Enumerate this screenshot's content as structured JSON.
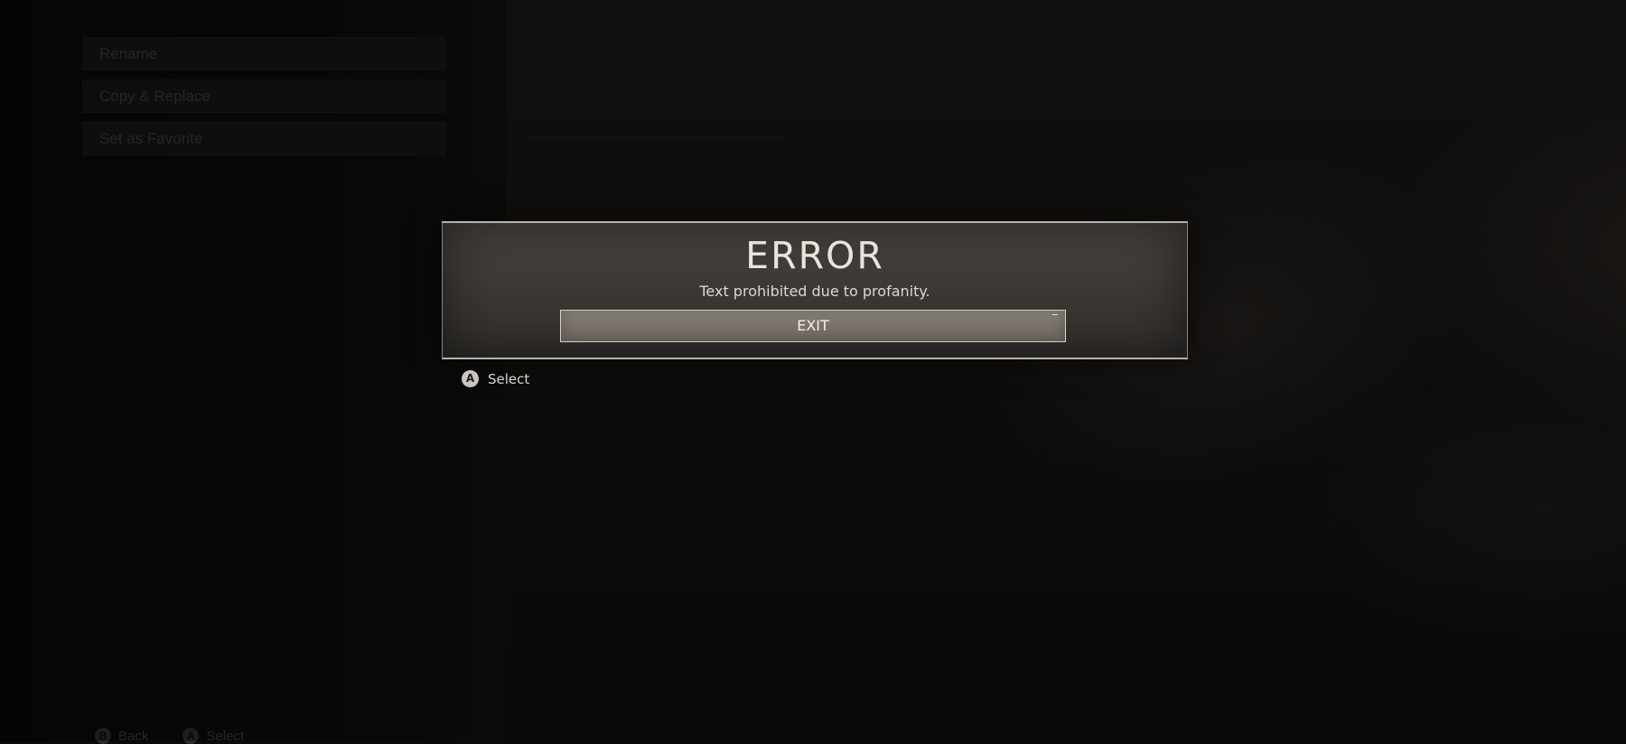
{
  "background": {
    "menu_items": [
      {
        "label": "Rename"
      },
      {
        "label": "Copy & Replace"
      },
      {
        "label": "Set as Favorite"
      }
    ],
    "bottom_prompts": [
      {
        "button": "B",
        "label": "Back"
      },
      {
        "button": "A",
        "label": "Select"
      }
    ]
  },
  "dialog": {
    "title": "ERROR",
    "message": "Text prohibited due to profanity.",
    "exit_label": "EXIT"
  },
  "dialog_prompt": {
    "button": "A",
    "label": "Select"
  },
  "colors": {
    "dialog_bg": "#3b3834",
    "dialog_border": "#b8b1a6",
    "button_bg": "#7a746c",
    "text_primary": "#e8e4de"
  }
}
